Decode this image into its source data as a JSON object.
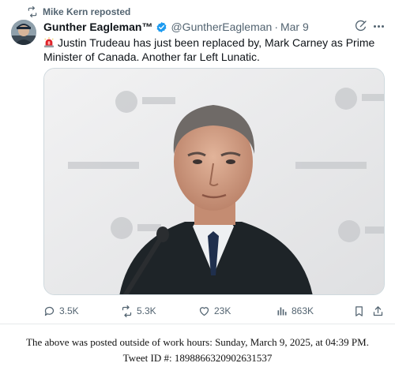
{
  "repost": {
    "label": "Mike Kern reposted",
    "icon": "repost-icon"
  },
  "author": {
    "display_name": "Gunther Eagleman™",
    "handle": "@GuntherEagleman",
    "separator": "·",
    "timestamp": "Mar 9",
    "verified": true,
    "verified_color": "#1d9bf0"
  },
  "tweet": {
    "leading_emoji": "siren-emoji",
    "text": "Justin Trudeau has just been replaced by, Mark Carney as Prime Minister of Canada. Another far Left Lunatic."
  },
  "media": {
    "icon": "photo-of-man-at-microphone"
  },
  "actions": {
    "replies": "3.5K",
    "reposts": "5.3K",
    "likes": "23K",
    "views": "863K"
  },
  "footer": {
    "line1": "The above was posted outside of work hours: Sunday, March 9, 2025, at 04:39 PM.",
    "line2": "Tweet ID #: 1898866320902631537"
  },
  "colors": {
    "text": "#0f1419",
    "muted": "#536471",
    "accent": "#1d9bf0"
  }
}
